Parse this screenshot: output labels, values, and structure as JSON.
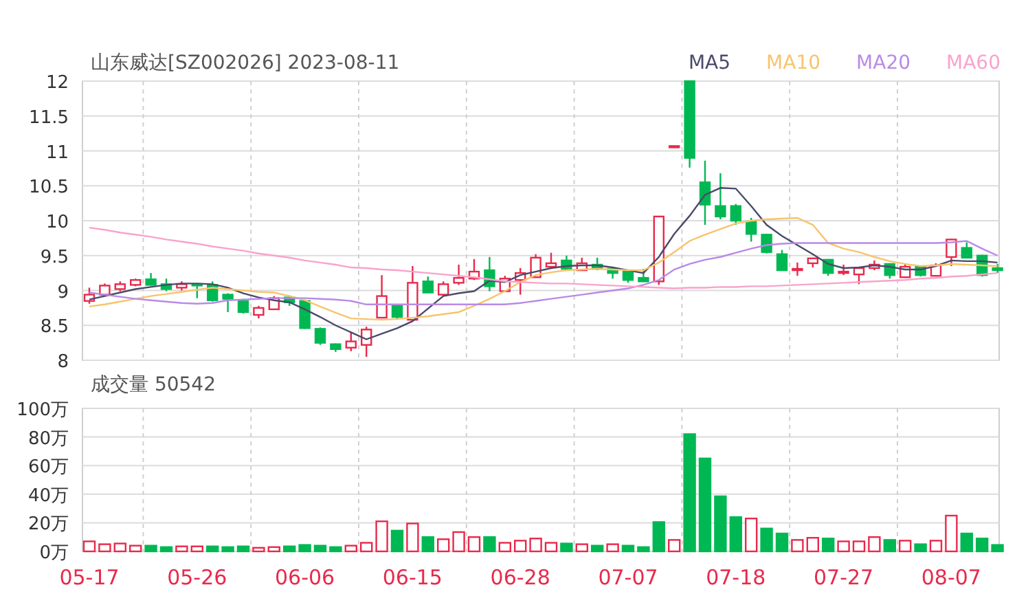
{
  "title": "山东威达[SZ002026] 2023-08-11",
  "price_chart": {
    "chart_data": {
      "type": "candlestick",
      "grid": true,
      "ylim": [
        8,
        12
      ],
      "yticks": [
        8,
        {
          "value": 8.5,
          "label": "8.5"
        },
        9,
        {
          "value": 9.5,
          "label": "9.5"
        },
        10,
        {
          "value": 10.5,
          "label": "10.5"
        },
        11,
        {
          "value": 11.5,
          "label": "11.5"
        },
        12
      ],
      "ohlc": [
        [
          8.85,
          9.04,
          8.81,
          8.94
        ],
        [
          8.94,
          9.1,
          8.92,
          9.07
        ],
        [
          9.02,
          9.13,
          8.99,
          9.09
        ],
        [
          9.08,
          9.17,
          9.06,
          9.15
        ],
        [
          9.16,
          9.25,
          9.07,
          9.08
        ],
        [
          9.09,
          9.17,
          8.99,
          9.02
        ],
        [
          9.04,
          9.13,
          9.0,
          9.09
        ],
        [
          9.09,
          9.1,
          8.89,
          9.08
        ],
        [
          9.08,
          9.13,
          8.84,
          8.86
        ],
        [
          8.94,
          8.96,
          8.69,
          8.88
        ],
        [
          8.85,
          8.88,
          8.67,
          8.69
        ],
        [
          8.65,
          8.78,
          8.6,
          8.75
        ],
        [
          8.73,
          8.92,
          8.72,
          8.89
        ],
        [
          8.9,
          8.93,
          8.78,
          8.83
        ],
        [
          8.85,
          8.87,
          8.45,
          8.46
        ],
        [
          8.45,
          8.47,
          8.22,
          8.25
        ],
        [
          8.23,
          8.24,
          8.12,
          8.16
        ],
        [
          8.18,
          8.4,
          8.13,
          8.27
        ],
        [
          8.22,
          8.48,
          8.05,
          8.44
        ],
        [
          8.61,
          9.22,
          8.6,
          8.92
        ],
        [
          8.79,
          8.8,
          8.58,
          8.62
        ],
        [
          8.58,
          9.35,
          8.58,
          9.11
        ],
        [
          9.13,
          9.2,
          8.96,
          8.97
        ],
        [
          8.94,
          9.13,
          8.93,
          9.09
        ],
        [
          9.11,
          9.37,
          9.08,
          9.18
        ],
        [
          9.17,
          9.45,
          9.15,
          9.27
        ],
        [
          9.29,
          9.48,
          8.99,
          9.06
        ],
        [
          8.99,
          9.21,
          8.98,
          9.17
        ],
        [
          9.15,
          9.32,
          8.94,
          9.25
        ],
        [
          9.19,
          9.52,
          9.18,
          9.47
        ],
        [
          9.34,
          9.54,
          9.33,
          9.39
        ],
        [
          9.43,
          9.5,
          9.3,
          9.31
        ],
        [
          9.29,
          9.47,
          9.28,
          9.39
        ],
        [
          9.37,
          9.47,
          9.29,
          9.31
        ],
        [
          9.31,
          9.33,
          9.17,
          9.25
        ],
        [
          9.27,
          9.28,
          9.11,
          9.15
        ],
        [
          9.18,
          9.31,
          9.12,
          9.13
        ],
        [
          9.13,
          10.06,
          9.08,
          10.06
        ],
        [
          11.07,
          11.07,
          11.07,
          11.07
        ],
        [
          12.0,
          12.0,
          10.76,
          10.9
        ],
        [
          10.55,
          10.86,
          9.94,
          10.23
        ],
        [
          10.21,
          10.68,
          10.02,
          10.06
        ],
        [
          10.21,
          10.24,
          9.94,
          10.0
        ],
        [
          9.99,
          10.04,
          9.7,
          9.81
        ],
        [
          9.8,
          9.81,
          9.53,
          9.55
        ],
        [
          9.52,
          9.58,
          9.29,
          9.29
        ],
        [
          9.29,
          9.4,
          9.21,
          9.31
        ],
        [
          9.39,
          9.47,
          9.33,
          9.46
        ],
        [
          9.44,
          9.45,
          9.21,
          9.25
        ],
        [
          9.25,
          9.37,
          9.22,
          9.27
        ],
        [
          9.23,
          9.33,
          9.09,
          9.32
        ],
        [
          9.32,
          9.43,
          9.29,
          9.37
        ],
        [
          9.38,
          9.39,
          9.17,
          9.22
        ],
        [
          9.19,
          9.38,
          9.18,
          9.34
        ],
        [
          9.34,
          9.35,
          9.2,
          9.22
        ],
        [
          9.21,
          9.39,
          9.2,
          9.36
        ],
        [
          9.48,
          9.74,
          9.35,
          9.73
        ],
        [
          9.61,
          9.69,
          9.46,
          9.47
        ],
        [
          9.5,
          9.51,
          9.2,
          9.22
        ],
        [
          9.32,
          9.38,
          9.25,
          9.29
        ]
      ]
    }
  },
  "moving_averages": {
    "chart_data": {
      "type": "line",
      "ylim": [
        8,
        12
      ],
      "series": [
        {
          "name": "MA5",
          "color": "#4a4a6a",
          "values": [
            8.87,
            8.92,
            8.97,
            9.02,
            9.05,
            9.08,
            9.1,
            9.1,
            9.09,
            9.04,
            8.96,
            8.9,
            8.86,
            8.83,
            8.73,
            8.62,
            8.5,
            8.4,
            8.3,
            8.38,
            8.46,
            8.56,
            8.74,
            8.92,
            8.96,
            8.99,
            9.14,
            9.12,
            9.22,
            9.27,
            9.32,
            9.35,
            9.36,
            9.36,
            9.33,
            9.29,
            9.25,
            9.48,
            9.81,
            10.07,
            10.37,
            10.47,
            10.46,
            10.21,
            9.94,
            9.78,
            9.65,
            9.52,
            9.38,
            9.32,
            9.33,
            9.36,
            9.34,
            9.3,
            9.3,
            9.35,
            9.43,
            9.42,
            9.42,
            9.4
          ]
        },
        {
          "name": "MA10",
          "color": "#f7c46c",
          "values": [
            8.77,
            8.8,
            8.84,
            8.88,
            8.92,
            8.95,
            8.98,
            9.01,
            9.04,
            9.02,
            9.0,
            8.98,
            8.97,
            8.92,
            8.86,
            8.77,
            8.68,
            8.6,
            8.59,
            8.58,
            8.59,
            8.61,
            8.63,
            8.66,
            8.69,
            8.78,
            8.88,
            8.99,
            9.12,
            9.22,
            9.26,
            9.29,
            9.3,
            9.31,
            9.3,
            9.29,
            9.29,
            9.4,
            9.55,
            9.71,
            9.8,
            9.88,
            9.96,
            10.0,
            10.02,
            10.03,
            10.04,
            9.94,
            9.68,
            9.6,
            9.55,
            9.48,
            9.42,
            9.38,
            9.35,
            9.36,
            9.38,
            9.37,
            9.36,
            9.35
          ]
        },
        {
          "name": "MA20",
          "color": "#b98ae6",
          "values": [
            8.97,
            8.94,
            8.91,
            8.88,
            8.86,
            8.84,
            8.82,
            8.81,
            8.82,
            8.86,
            8.87,
            8.88,
            8.89,
            8.89,
            8.89,
            8.88,
            8.87,
            8.85,
            8.8,
            8.8,
            8.8,
            8.8,
            8.8,
            8.8,
            8.8,
            8.8,
            8.8,
            8.8,
            8.82,
            8.85,
            8.88,
            8.91,
            8.94,
            8.97,
            9.0,
            9.03,
            9.08,
            9.15,
            9.3,
            9.38,
            9.44,
            9.48,
            9.54,
            9.6,
            9.65,
            9.67,
            9.68,
            9.68,
            9.68,
            9.68,
            9.68,
            9.68,
            9.68,
            9.68,
            9.68,
            9.68,
            9.69,
            9.71,
            9.6,
            9.5
          ]
        },
        {
          "name": "MA60",
          "color": "#f8a3cc",
          "values": [
            9.9,
            9.87,
            9.83,
            9.8,
            9.77,
            9.73,
            9.7,
            9.67,
            9.63,
            9.6,
            9.57,
            9.53,
            9.5,
            9.47,
            9.43,
            9.4,
            9.37,
            9.33,
            9.32,
            9.3,
            9.29,
            9.27,
            9.25,
            9.23,
            9.21,
            9.19,
            9.16,
            9.13,
            9.12,
            9.11,
            9.1,
            9.1,
            9.09,
            9.08,
            9.07,
            9.06,
            9.05,
            9.04,
            9.03,
            9.04,
            9.04,
            9.05,
            9.05,
            9.06,
            9.06,
            9.07,
            9.08,
            9.09,
            9.1,
            9.11,
            9.12,
            9.13,
            9.14,
            9.15,
            9.17,
            9.18,
            9.2,
            9.21,
            9.23,
            9.25
          ]
        }
      ]
    }
  },
  "volume": {
    "label": "成交量 50542",
    "chart_data": {
      "type": "bar",
      "grid": true,
      "ylim": [
        0,
        100
      ],
      "yticks": [
        {
          "value": 0,
          "label": "0万"
        },
        {
          "value": 20,
          "label": "20万"
        },
        {
          "value": 40,
          "label": "40万"
        },
        {
          "value": 60,
          "label": "60万"
        },
        {
          "value": 80,
          "label": "80万"
        },
        {
          "value": 100,
          "label": "100万"
        }
      ],
      "categories": [
        "05-17",
        null,
        null,
        null,
        null,
        null,
        null,
        "05-26",
        null,
        null,
        null,
        null,
        null,
        null,
        "06-06",
        null,
        null,
        null,
        null,
        null,
        null,
        "06-15",
        null,
        null,
        null,
        null,
        null,
        null,
        "06-28",
        null,
        null,
        null,
        null,
        null,
        null,
        "07-07",
        null,
        null,
        null,
        null,
        null,
        null,
        "07-18",
        null,
        null,
        null,
        null,
        null,
        null,
        "07-27",
        null,
        null,
        null,
        null,
        null,
        null,
        "08-07",
        null,
        null,
        null
      ],
      "series": [
        {
          "color": "#e8294b",
          "values": [
            7,
            5,
            5.5,
            4,
            null,
            null,
            3.5,
            3.5,
            null,
            null,
            null,
            2.5,
            3,
            null,
            null,
            null,
            null,
            4,
            6,
            21,
            null,
            19.5,
            null,
            8.5,
            13.5,
            10,
            null,
            6,
            7.5,
            9,
            6,
            null,
            5,
            null,
            5,
            null,
            null,
            null,
            8,
            null,
            null,
            null,
            null,
            23,
            null,
            null,
            8,
            9.5,
            null,
            7,
            7,
            10,
            null,
            7.5,
            null,
            7.5,
            25,
            null,
            null,
            null
          ]
        },
        {
          "color": "#00b853",
          "values": [
            null,
            null,
            null,
            null,
            4,
            3,
            null,
            null,
            3.5,
            3,
            3.5,
            null,
            null,
            3.5,
            4.5,
            4,
            3,
            null,
            null,
            null,
            14.5,
            null,
            10,
            null,
            null,
            null,
            10,
            null,
            null,
            null,
            null,
            5.5,
            null,
            4,
            null,
            4,
            3,
            20.5,
            null,
            82,
            65,
            38.5,
            24,
            null,
            16,
            12.5,
            null,
            null,
            9,
            null,
            null,
            null,
            8,
            null,
            5,
            null,
            null,
            12.5,
            9,
            4.5
          ]
        }
      ]
    }
  }
}
